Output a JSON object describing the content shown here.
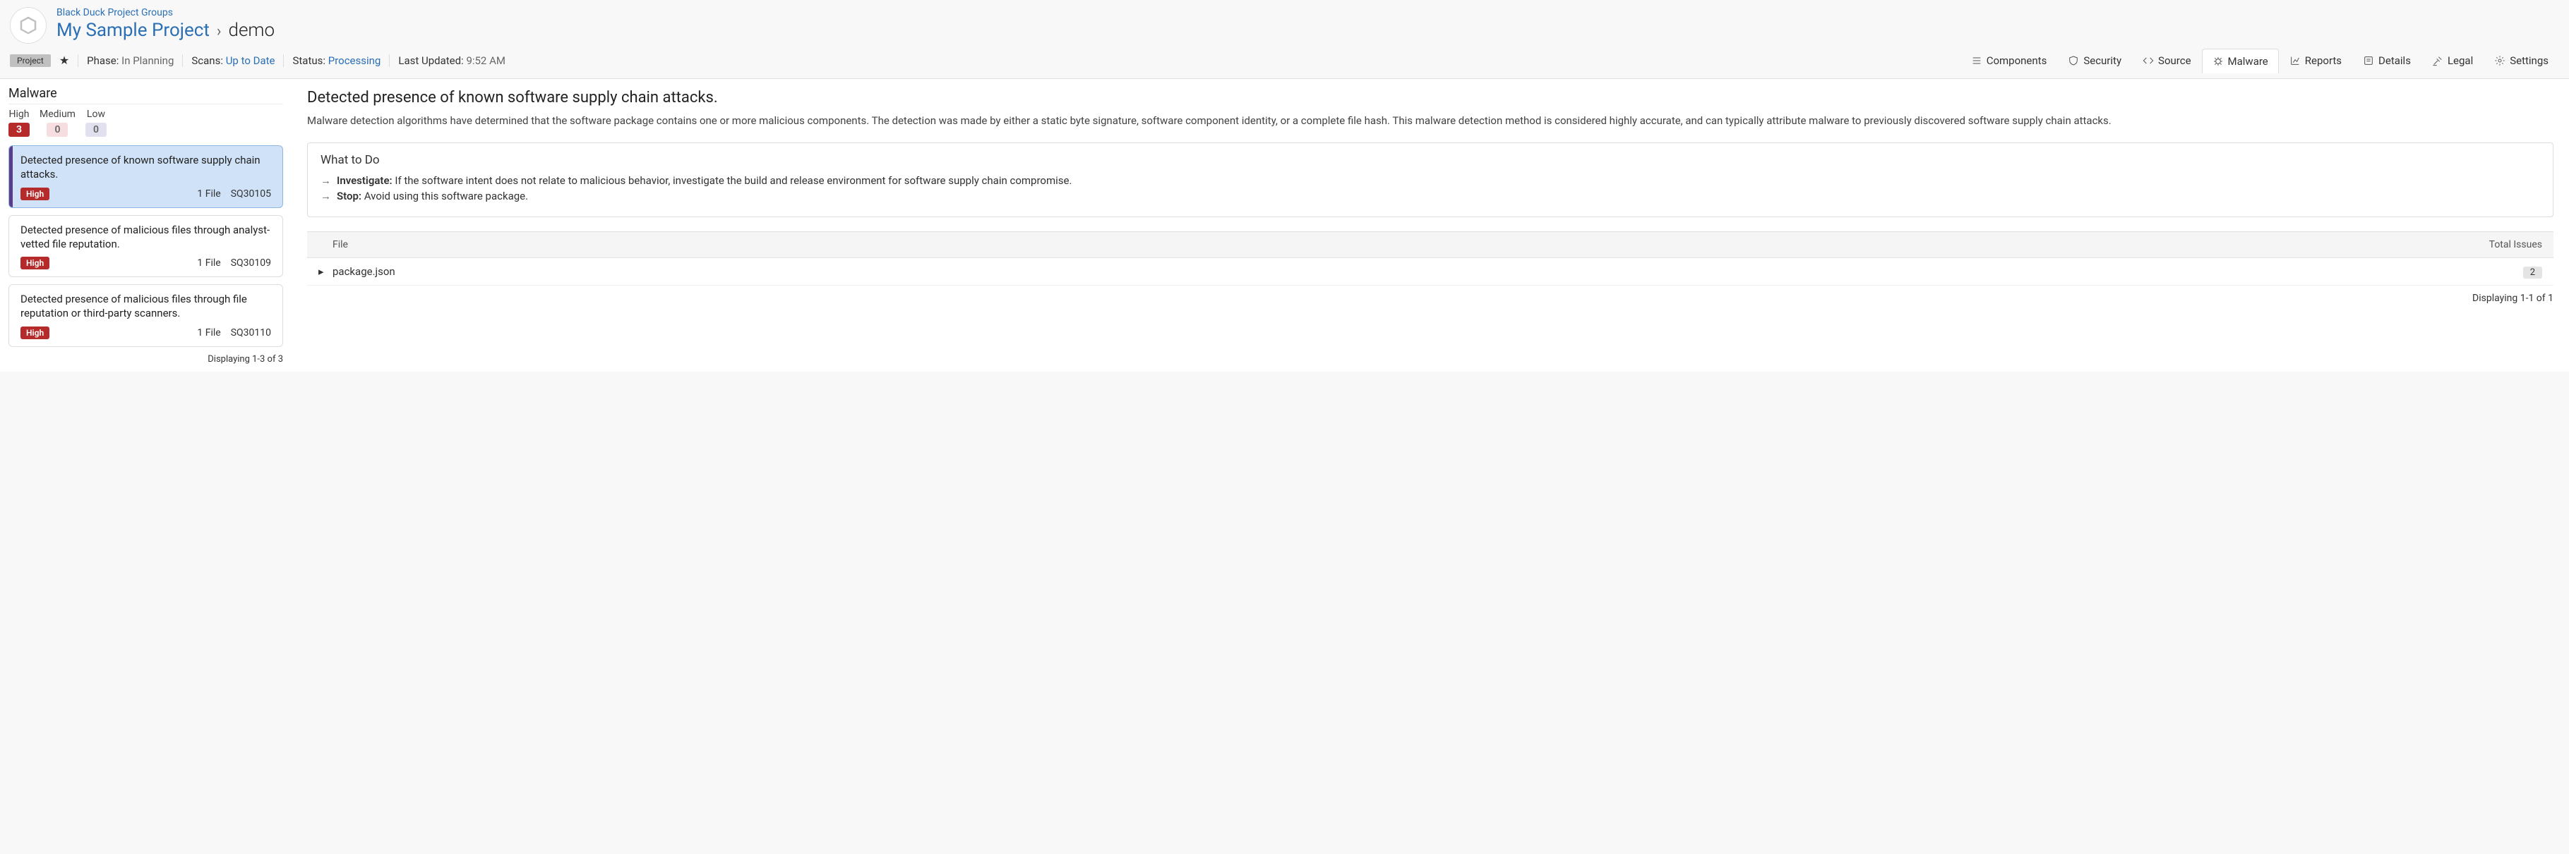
{
  "header": {
    "group_link": "Black Duck Project Groups",
    "project_name": "My Sample Project",
    "sub_name": "demo"
  },
  "toolbar": {
    "project_pill": "Project",
    "phase_label": "Phase:",
    "phase_value": "In Planning",
    "scans_label": "Scans:",
    "scans_value": "Up to Date",
    "status_label": "Status:",
    "status_value": "Processing",
    "updated_label": "Last Updated:",
    "updated_value": "9:52 AM"
  },
  "tabs": {
    "components": "Components",
    "security": "Security",
    "source": "Source",
    "malware": "Malware",
    "reports": "Reports",
    "details": "Details",
    "legal": "Legal",
    "settings": "Settings"
  },
  "sidebar": {
    "title": "Malware",
    "sev": {
      "high_label": "High",
      "high_count": "3",
      "med_label": "Medium",
      "med_count": "0",
      "low_label": "Low",
      "low_count": "0"
    },
    "cards": [
      {
        "title": "Detected presence of known software supply chain attacks.",
        "sev": "High",
        "files": "1 File",
        "id": "SQ30105"
      },
      {
        "title": "Detected presence of malicious files through analyst-vetted file reputation.",
        "sev": "High",
        "files": "1 File",
        "id": "SQ30109"
      },
      {
        "title": "Detected presence of malicious files through file reputation or third-party scanners.",
        "sev": "High",
        "files": "1 File",
        "id": "SQ30110"
      }
    ],
    "footer": "Displaying 1-3 of 3"
  },
  "main": {
    "heading": "Detected presence of known software supply chain attacks.",
    "desc": "Malware detection algorithms have determined that the software package contains one or more malicious components. The detection was made by either a static byte signature, software component identity, or a complete file hash. This malware detection method is considered highly accurate, and can typically attribute malware to previously discovered software supply chain attacks.",
    "todo_title": "What to Do",
    "todo": [
      {
        "label": "Investigate:",
        "text": "If the software intent does not relate to malicious behavior, investigate the build and release environment for software supply chain compromise."
      },
      {
        "label": "Stop:",
        "text": "Avoid using this software package."
      }
    ],
    "table": {
      "col_file": "File",
      "col_issues": "Total Issues",
      "rows": [
        {
          "file": "package.json",
          "issues": "2"
        }
      ]
    },
    "footer": "Displaying 1-1 of 1"
  }
}
